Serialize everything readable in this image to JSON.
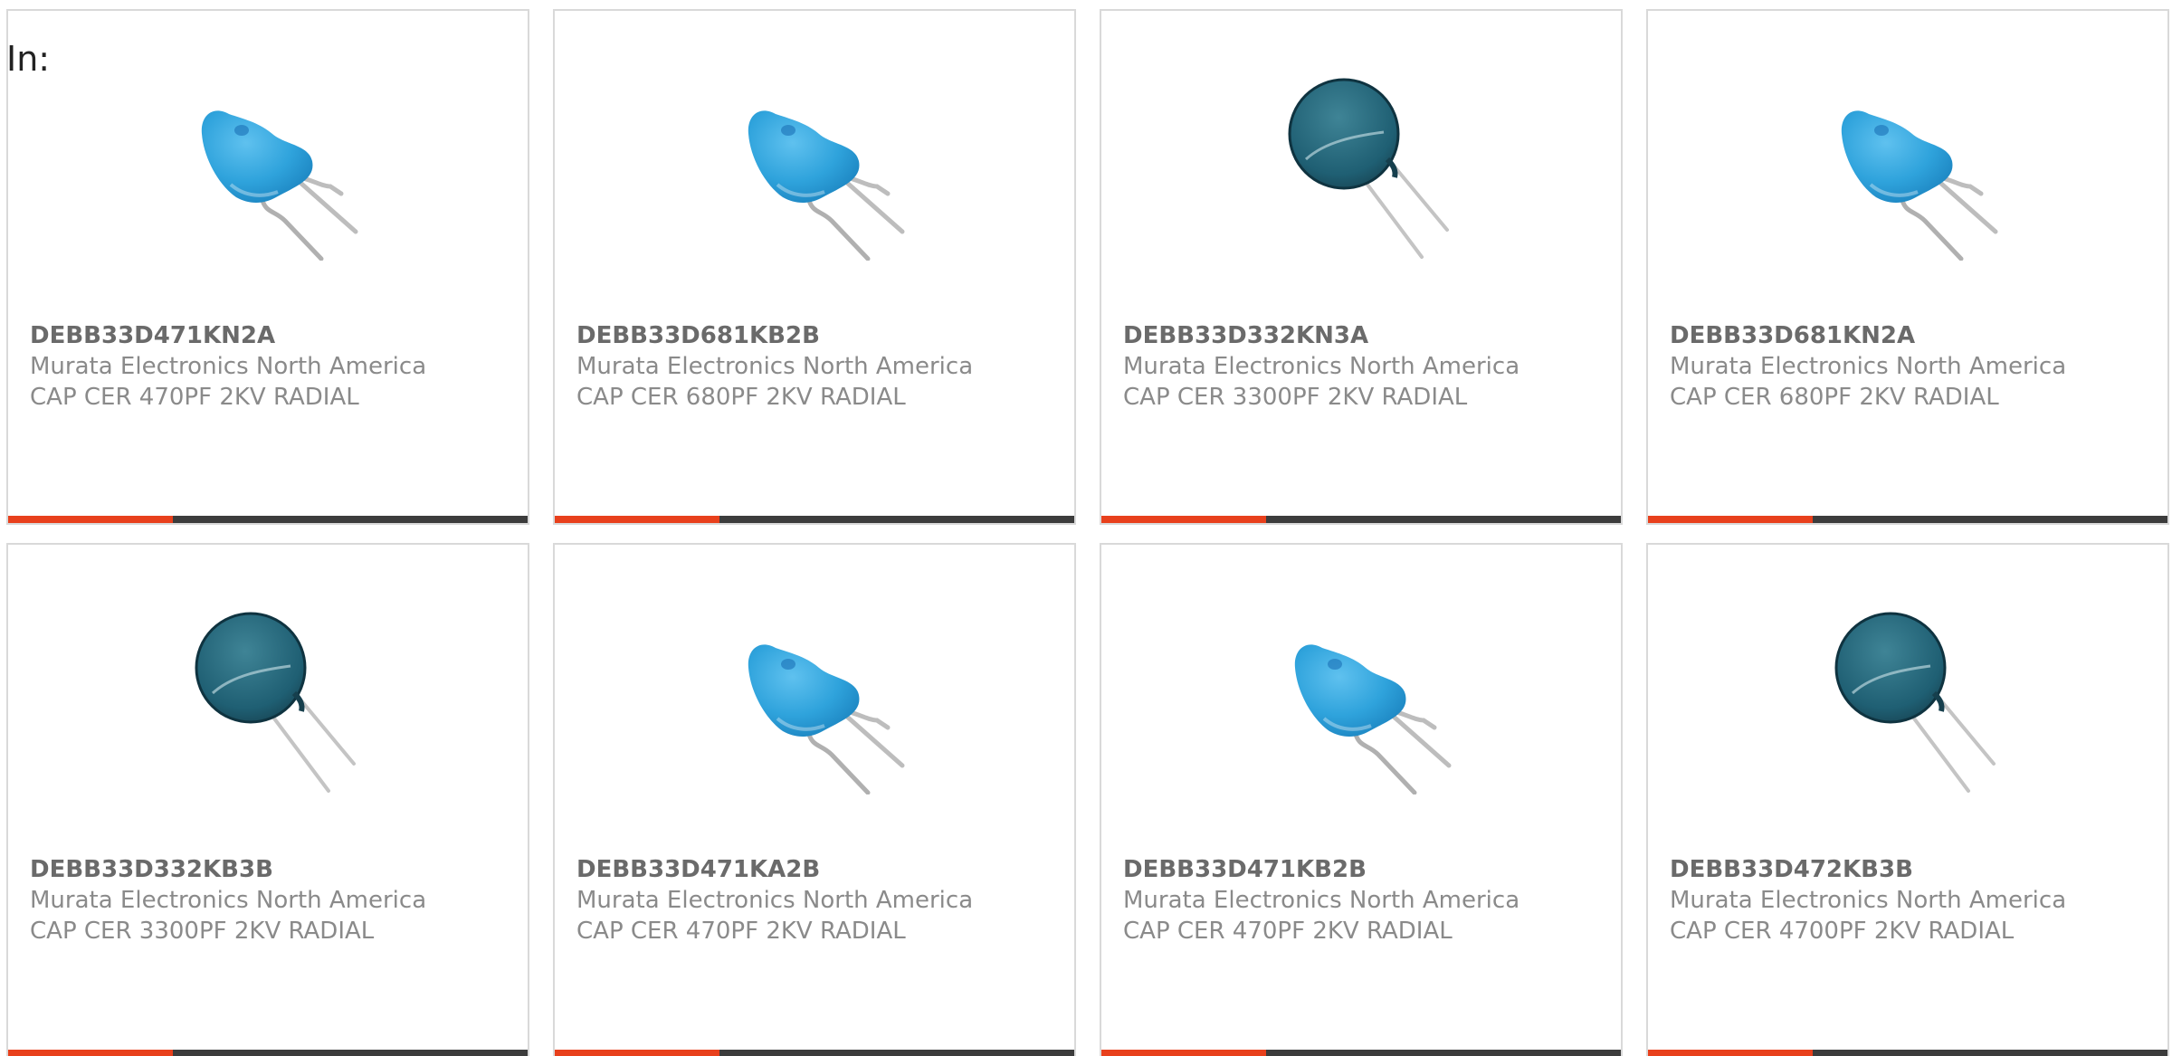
{
  "header": {
    "label": "In:"
  },
  "colors": {
    "accent": "#e8401c",
    "bar": "#3c3c3c",
    "border": "#d9d9d9",
    "blue_capacitor": "#3aa6dc",
    "teal_capacitor": "#1f5f73"
  },
  "products": [
    {
      "part_number": "DEBB33D471KN2A",
      "manufacturer": "Murata Electronics North America",
      "description": "CAP CER 470PF 2KV RADIAL",
      "image_icon": "blue-disc-capacitor-icon"
    },
    {
      "part_number": "DEBB33D681KB2B",
      "manufacturer": "Murata Electronics North America",
      "description": "CAP CER 680PF 2KV RADIAL",
      "image_icon": "blue-disc-capacitor-icon"
    },
    {
      "part_number": "DEBB33D332KN3A",
      "manufacturer": "Murata Electronics North America",
      "description": "CAP CER 3300PF 2KV RADIAL",
      "image_icon": "teal-disc-capacitor-icon"
    },
    {
      "part_number": "DEBB33D681KN2A",
      "manufacturer": "Murata Electronics North America",
      "description": "CAP CER 680PF 2KV RADIAL",
      "image_icon": "blue-disc-capacitor-icon"
    },
    {
      "part_number": "DEBB33D332KB3B",
      "manufacturer": "Murata Electronics North America",
      "description": "CAP CER 3300PF 2KV RADIAL",
      "image_icon": "teal-disc-capacitor-icon"
    },
    {
      "part_number": "DEBB33D471KA2B",
      "manufacturer": "Murata Electronics North America",
      "description": "CAP CER 470PF 2KV RADIAL",
      "image_icon": "blue-disc-capacitor-icon"
    },
    {
      "part_number": "DEBB33D471KB2B",
      "manufacturer": "Murata Electronics North America",
      "description": "CAP CER 470PF 2KV RADIAL",
      "image_icon": "blue-disc-capacitor-icon"
    },
    {
      "part_number": "DEBB33D472KB3B",
      "manufacturer": "Murata Electronics North America",
      "description": "CAP CER 4700PF 2KV RADIAL",
      "image_icon": "teal-disc-capacitor-icon"
    }
  ]
}
